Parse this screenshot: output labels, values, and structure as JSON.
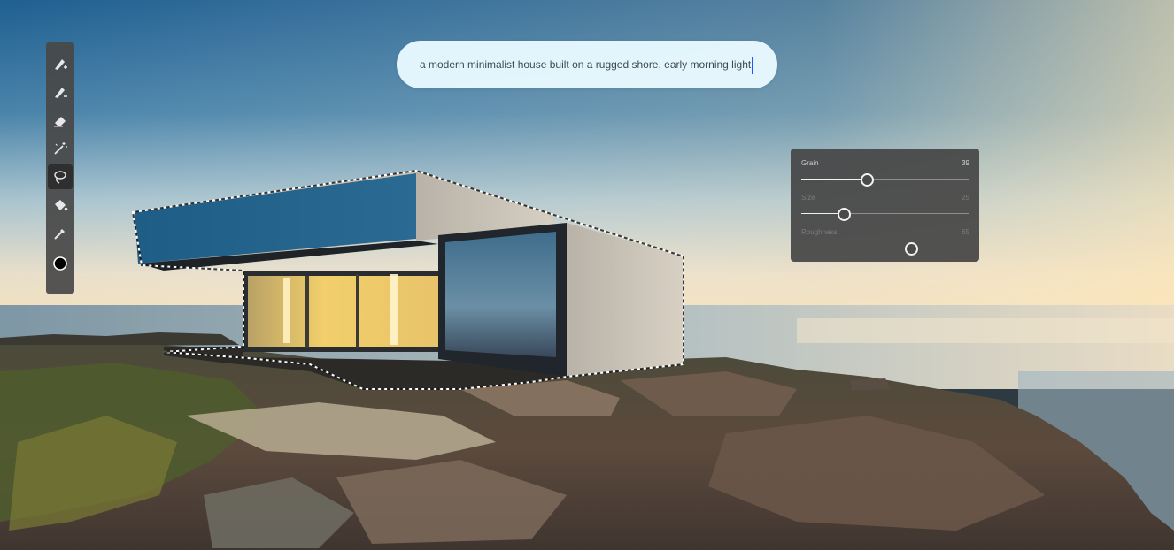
{
  "prompt": {
    "text": "a modern minimalist house built on a rugged shore, early morning light"
  },
  "toolbar": {
    "tools": [
      {
        "name": "brush-add-icon"
      },
      {
        "name": "brush-subtract-icon"
      },
      {
        "name": "eraser-icon"
      },
      {
        "name": "magic-wand-icon"
      },
      {
        "name": "lasso-icon",
        "active": true
      },
      {
        "name": "paint-bucket-icon"
      },
      {
        "name": "eyedropper-icon"
      },
      {
        "name": "color-swatch-icon",
        "color": "#000000"
      }
    ]
  },
  "adjustments": {
    "grain": {
      "label": "Grain",
      "value": "39",
      "fraction": 0.39
    },
    "size": {
      "label": "Size",
      "value": "25",
      "fraction": 0.25
    },
    "roughness": {
      "label": "Roughness",
      "value": "65",
      "fraction": 0.65
    }
  },
  "colors": {
    "prompt_background": "#e9faff",
    "cursor": "#2255ff",
    "panel_background": "#464646",
    "toolbar_background": "#484848"
  }
}
